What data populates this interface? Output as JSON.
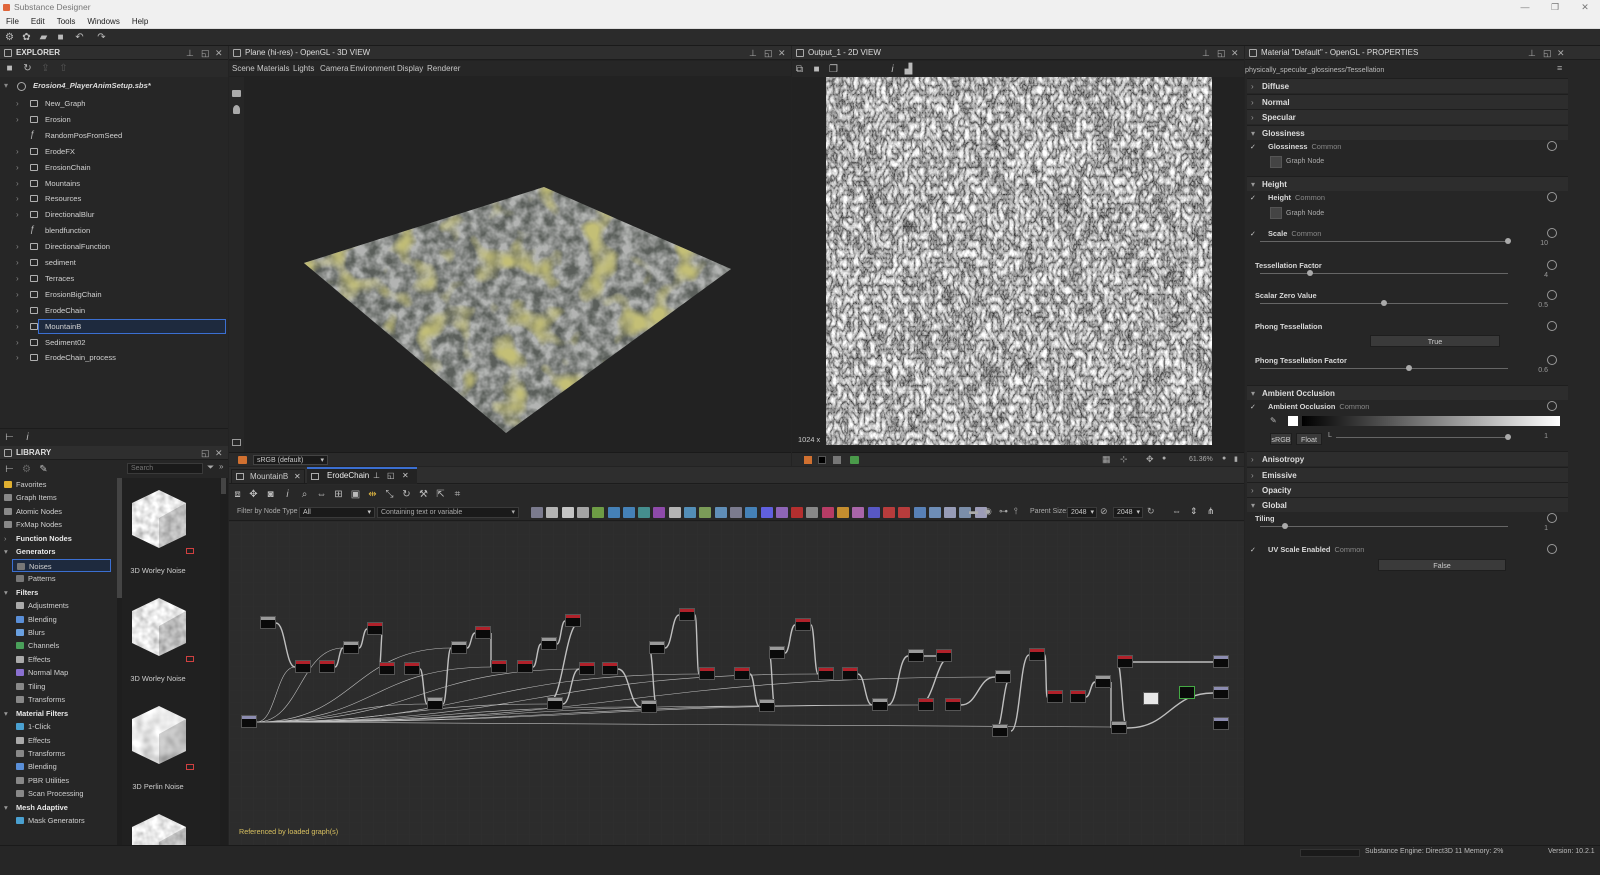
{
  "window": {
    "title": "Substance Designer",
    "minimize": "—",
    "restore": "❐",
    "close": "✕"
  },
  "menu": [
    "File",
    "Edit",
    "Tools",
    "Windows",
    "Help"
  ],
  "explorer": {
    "title": "EXPLORER",
    "package": "Erosion4_PlayerAnimSetup.sbs*",
    "items": [
      {
        "label": "New_Graph",
        "type": "graph"
      },
      {
        "label": "Erosion",
        "type": "graph"
      },
      {
        "label": "RandomPosFromSeed",
        "type": "function"
      },
      {
        "label": "ErodeFX",
        "type": "graph"
      },
      {
        "label": "ErosionChain",
        "type": "graph"
      },
      {
        "label": "Mountains",
        "type": "graph"
      },
      {
        "label": "Resources",
        "type": "folder"
      },
      {
        "label": "DirectionalBlur",
        "type": "graph"
      },
      {
        "label": "blendfunction",
        "type": "function"
      },
      {
        "label": "DirectionalFunction",
        "type": "graph"
      },
      {
        "label": "sediment",
        "type": "graph"
      },
      {
        "label": "Terraces",
        "type": "graph"
      },
      {
        "label": "ErosionBigChain",
        "type": "graph"
      },
      {
        "label": "ErodeChain",
        "type": "graph"
      },
      {
        "label": "MountainB",
        "type": "graph",
        "selected": true
      },
      {
        "label": "Sediment02",
        "type": "graph"
      },
      {
        "label": "ErodeChain_process",
        "type": "graph"
      }
    ]
  },
  "view3d": {
    "title": "Plane (hi-res) - OpenGL - 3D VIEW",
    "menu": [
      "Scene",
      "Materials",
      "Lights",
      "Camera",
      "Environment",
      "Display",
      "Renderer"
    ],
    "colorspace": "sRGB (default)"
  },
  "view2d": {
    "title": "Output_1 - 2D VIEW",
    "resolution": "1024 x",
    "zoom": "61.36%"
  },
  "properties": {
    "title": "Material \"Default\" - OpenGL - PROPERTIES",
    "path": "physically_specular_glossiness/Tessellation",
    "sections": [
      "Diffuse",
      "Normal",
      "Specular",
      "Glossiness",
      "Height",
      "Ambient Occlusion",
      "Anisotropy",
      "Emissive",
      "Opacity",
      "Global"
    ],
    "common": "Common",
    "graph_node": "Graph Node",
    "glossiness_label": "Glossiness",
    "height_label": "Height",
    "scale_label": "Scale",
    "scale_value": "10",
    "tess_factor_label": "Tessellation Factor",
    "tess_factor_value": "4",
    "scalar_zero_label": "Scalar Zero Value",
    "scalar_zero_value": "0.5",
    "phong_label": "Phong Tessellation",
    "phong_value": "True",
    "phong_factor_label": "Phong Tessellation Factor",
    "phong_factor_value": "0.6",
    "ao_label": "Ambient Occlusion",
    "ao_srgb": "sRGB",
    "ao_float": "Float",
    "ao_l": "L",
    "ao_value": "1",
    "tiling_label": "Tiling",
    "tiling_value": "1",
    "uv_label": "UV Scale Enabled",
    "uv_value": "False"
  },
  "library": {
    "title": "LIBRARY",
    "search_placeholder": "Search",
    "categories": [
      {
        "label": "Favorites",
        "head": false,
        "color": "#e0b030"
      },
      {
        "label": "Graph Items",
        "head": false,
        "color": "#888"
      },
      {
        "label": "Atomic Nodes",
        "head": false,
        "color": "#888"
      },
      {
        "label": "FxMap Nodes",
        "head": false,
        "color": "#888"
      },
      {
        "label": "Function Nodes",
        "head": true
      },
      {
        "label": "Generators",
        "head": true
      },
      {
        "label": "Noises",
        "head": false,
        "color": "#777",
        "selected": true
      },
      {
        "label": "Patterns",
        "head": false,
        "color": "#777"
      },
      {
        "label": "Filters",
        "head": true
      },
      {
        "label": "Adjustments",
        "head": false,
        "color": "#aaa"
      },
      {
        "label": "Blending",
        "head": false,
        "color": "#5a8fd8"
      },
      {
        "label": "Blurs",
        "head": false,
        "color": "#6aa0e0"
      },
      {
        "label": "Channels",
        "head": false,
        "color": "#4aa05a"
      },
      {
        "label": "Effects",
        "head": false,
        "color": "#aaa"
      },
      {
        "label": "Normal Map",
        "head": false,
        "color": "#8a70d0"
      },
      {
        "label": "Tiling",
        "head": false,
        "color": "#888"
      },
      {
        "label": "Transforms",
        "head": false,
        "color": "#888"
      },
      {
        "label": "Material Filters",
        "head": true
      },
      {
        "label": "1-Click",
        "head": false,
        "color": "#4aa0d0"
      },
      {
        "label": "Effects",
        "head": false,
        "color": "#aaa"
      },
      {
        "label": "Transforms",
        "head": false,
        "color": "#888"
      },
      {
        "label": "Blending",
        "head": false,
        "color": "#5a8fd8"
      },
      {
        "label": "PBR Utilities",
        "head": false,
        "color": "#888"
      },
      {
        "label": "Scan Processing",
        "head": false,
        "color": "#888"
      },
      {
        "label": "Mesh Adaptive",
        "head": true
      },
      {
        "label": "Mask Generators",
        "head": false,
        "color": "#4aa0d0"
      }
    ],
    "thumbnails": [
      "3D Worley Noise",
      "3D Worley Noise",
      "3D Perlin Noise"
    ]
  },
  "graph": {
    "tabs": [
      {
        "label": "MountainB",
        "active": false
      },
      {
        "label": "ErodeChain",
        "active": true
      }
    ],
    "filter_label": "Filter by Node Type",
    "filter_value": "All",
    "containing_label": "Containing text or variable",
    "parent_size_label": "Parent Size:",
    "parent_size_value": "2048",
    "size_value": "2048",
    "footer": "Referenced by loaded graph(s)"
  },
  "status": {
    "engine": "Substance Engine: Direct3D 11  Memory: 2%",
    "version": "Version: 10.2.1"
  }
}
